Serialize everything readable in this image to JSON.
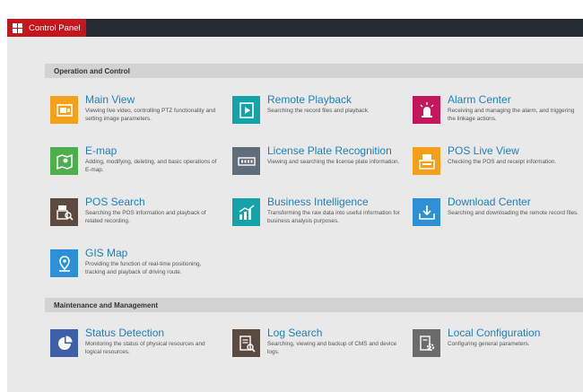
{
  "tab": {
    "label": "Control Panel"
  },
  "sections": {
    "operation": {
      "title": "Operation and Control"
    },
    "maintenance": {
      "title": "Maintenance and Management"
    }
  },
  "items": {
    "main_view": {
      "title": "Main View",
      "desc": "Viewing live video, controlling PTZ functionality and setting image parameters."
    },
    "remote_playback": {
      "title": "Remote Playback",
      "desc": "Searching the record files and playback."
    },
    "alarm_center": {
      "title": "Alarm Center",
      "desc": "Receiving and managing the alarm, and triggering the linkage actions."
    },
    "emap": {
      "title": "E-map",
      "desc": "Adding, modifying, deleting, and basic operations of E-map."
    },
    "lpr": {
      "title": "License Plate Recognition",
      "desc": "Viewing and searching the license plate information."
    },
    "pos_live": {
      "title": "POS Live View",
      "desc": "Checking the POS and receipt information."
    },
    "pos_search": {
      "title": "POS Search",
      "desc": "Searching the POS information and playback of related recording."
    },
    "bi": {
      "title": "Business Intelligence",
      "desc": "Transforming the raw data into useful information for business analysis purposes."
    },
    "download": {
      "title": "Download Center",
      "desc": "Searching and downloading the remote record files."
    },
    "gis": {
      "title": "GIS Map",
      "desc": "Providing the function of real-time positioning, tracking and playback of driving route."
    },
    "status": {
      "title": "Status Detection",
      "desc": "Monitoring the status of physical resources and logical resources."
    },
    "log": {
      "title": "Log Search",
      "desc": "Searching, viewing and backup of CMS and device logs."
    },
    "local_config": {
      "title": "Local Configuration",
      "desc": "Configuring general parameters."
    }
  },
  "colors": {
    "orange": "#f5a01a",
    "teal": "#14a3a8",
    "crimson": "#c2185b",
    "green": "#4cae4c",
    "slate": "#5f6d7a",
    "brown": "#5b4a40",
    "blue": "#2d8fd5",
    "gray": "#6b6b6b",
    "title_blue": "#1e7fc0",
    "accent_red": "#c4161c"
  }
}
